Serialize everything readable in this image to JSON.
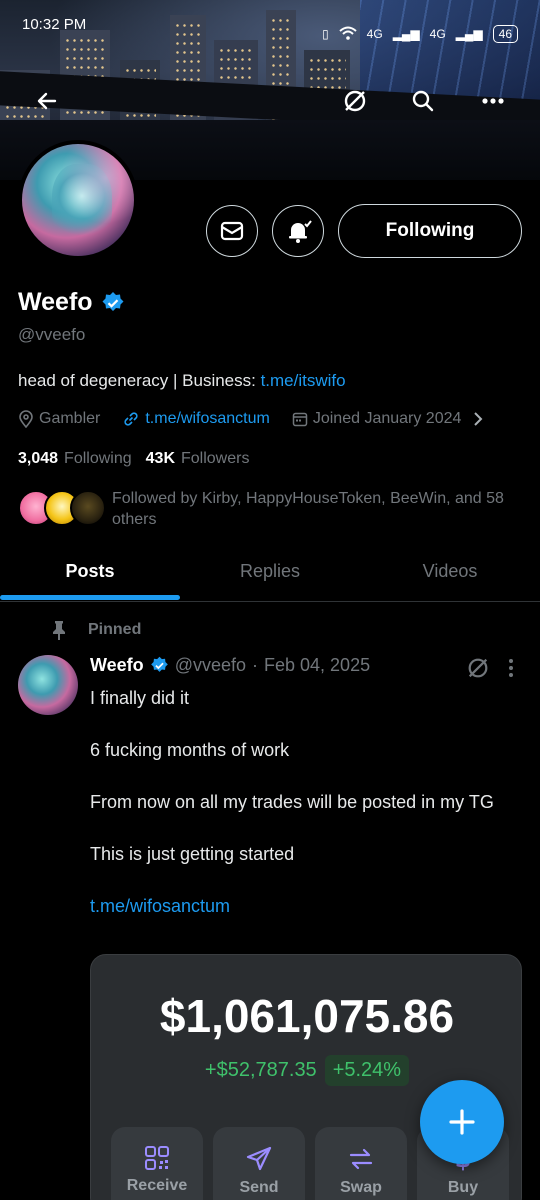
{
  "status": {
    "time": "10:32 PM",
    "network1": "4G",
    "network2": "4G",
    "battery": "46"
  },
  "profile": {
    "name": "Weefo",
    "handle": "@vveefo",
    "bio_prefix": "head of degeneracy | Business: ",
    "bio_link": "t.me/itswifo",
    "category": "Gambler",
    "website": "t.me/wifosanctum",
    "joined": "Joined January 2024",
    "following_count": "3,048",
    "following_label": "Following",
    "followers_count": "43K",
    "followers_label": "Followers",
    "followed_by": "Followed by Kirby, HappyHouseToken, BeeWin, and 58 others",
    "follow_button": "Following"
  },
  "tabs": [
    {
      "label": "Posts",
      "active": true
    },
    {
      "label": "Replies",
      "active": false
    },
    {
      "label": "Videos",
      "active": false
    }
  ],
  "post": {
    "pinned_label": "Pinned",
    "author": "Weefo",
    "handle": "@vveefo",
    "separator": "·",
    "date": "Feb 04, 2025",
    "lines": [
      "I finally did it",
      "6 fucking months of work",
      "From now on all my trades will be posted in my TG",
      "This is just getting started"
    ],
    "link": "t.me/wifosanctum",
    "card": {
      "amount": "$1,061,075.86",
      "change": "+$52,787.35",
      "percent": "+5.24%",
      "actions": [
        "Receive",
        "Send",
        "Swap",
        "Buy"
      ]
    }
  },
  "colors": {
    "accent": "#1d9bf0",
    "muted": "#71767b",
    "positive": "#3fc16b",
    "background": "#000000"
  },
  "icons": [
    "back-arrow-icon",
    "grok-icon",
    "search-icon",
    "more-icon",
    "mail-icon",
    "bell-icon",
    "location-icon",
    "link-icon",
    "calendar-icon",
    "pin-icon",
    "verified-icon",
    "plus-icon"
  ]
}
